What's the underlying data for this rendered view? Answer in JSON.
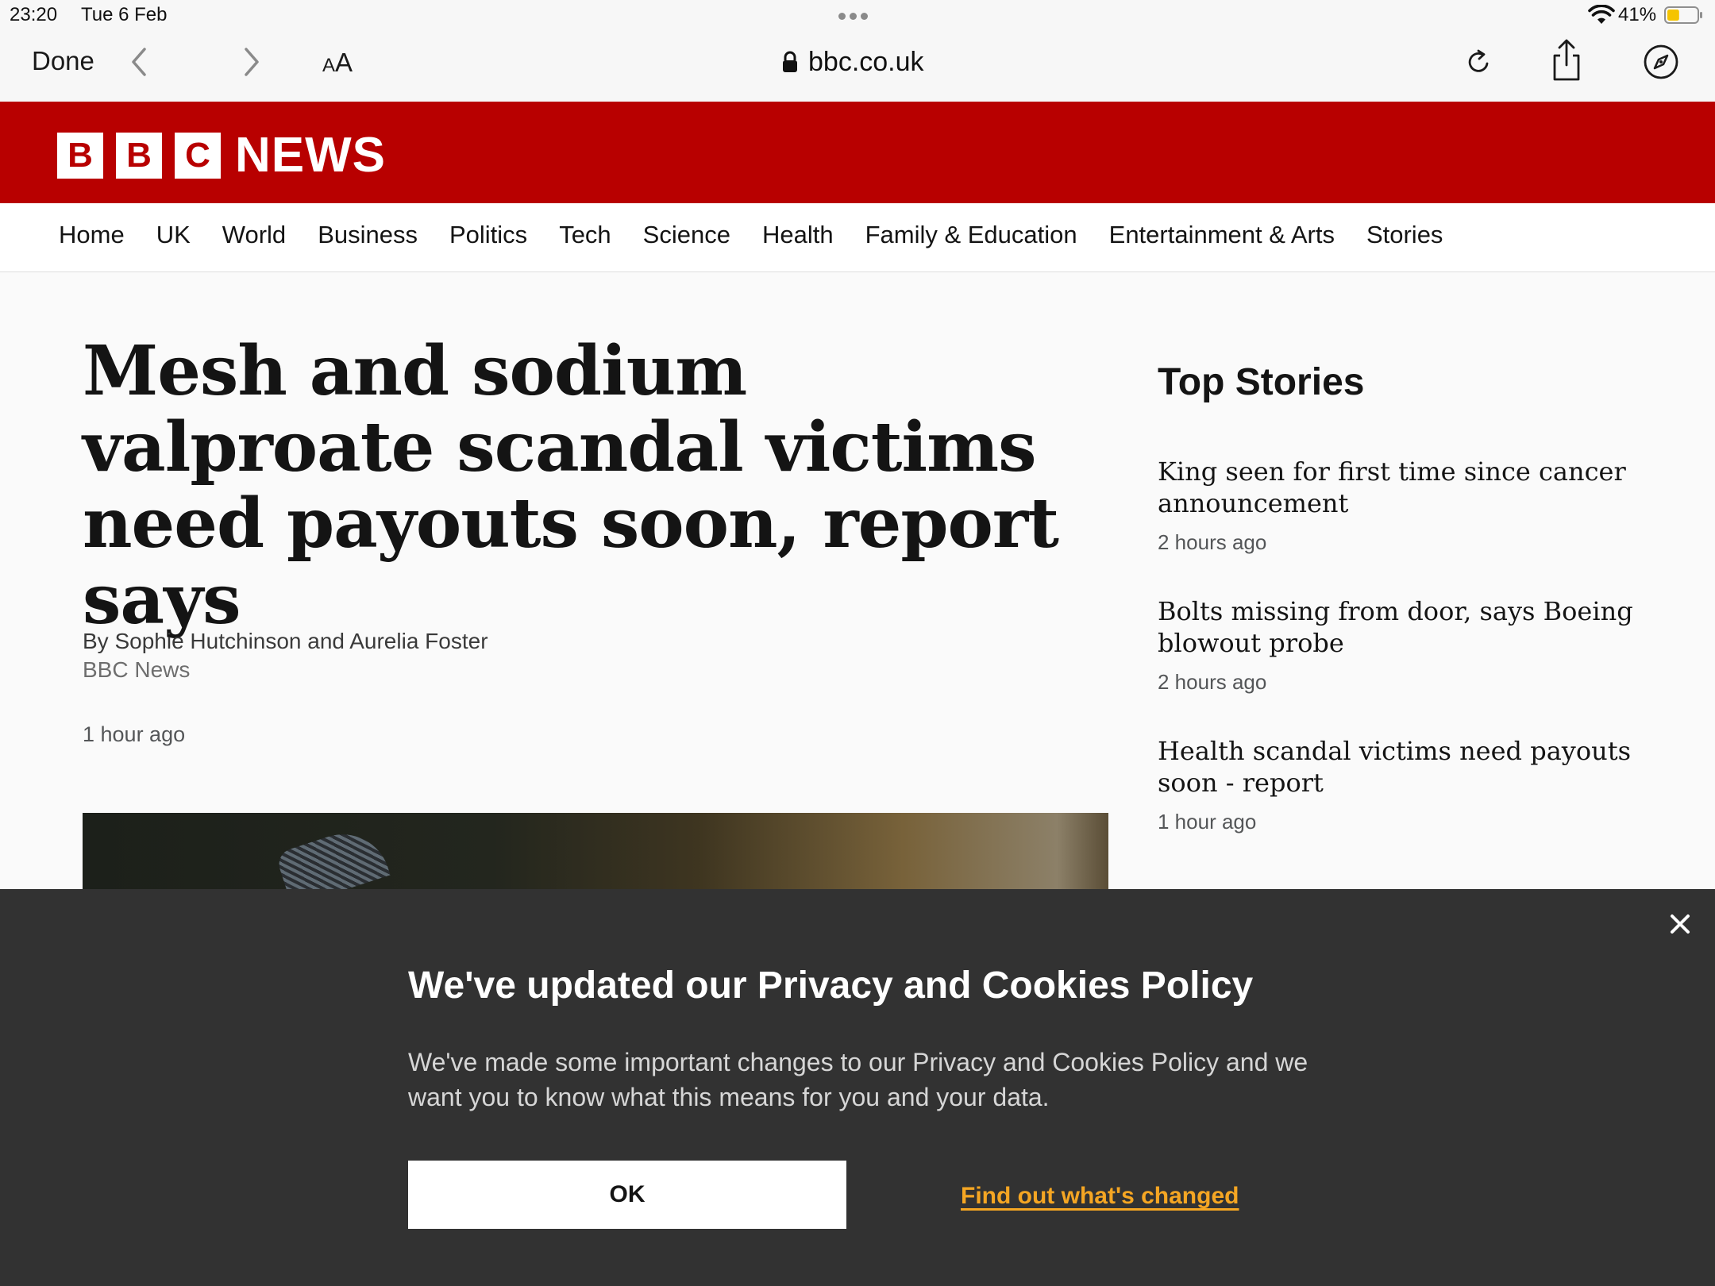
{
  "status_bar": {
    "time": "23:20",
    "date": "Tue 6 Feb",
    "battery_percent": "41%",
    "battery_level": 0.41,
    "battery_color": "#f5c400"
  },
  "toolbar": {
    "done_label": "Done",
    "text_size_small": "A",
    "text_size_large": "A",
    "url": "bbc.co.uk",
    "icons": [
      "back-icon",
      "forward-icon",
      "lock-icon",
      "reload-icon",
      "share-icon",
      "compass-icon"
    ]
  },
  "brand": {
    "blocks": [
      "B",
      "B",
      "C"
    ],
    "news": "NEWS",
    "header_color": "#b80000"
  },
  "nav": {
    "items": [
      "Home",
      "UK",
      "World",
      "Business",
      "Politics",
      "Tech",
      "Science",
      "Health",
      "Family & Education",
      "Entertainment & Arts",
      "Stories"
    ]
  },
  "article": {
    "headline": "Mesh and sodium valproate scandal victims need payouts soon, report says",
    "byline": "By Sophie Hutchinson and Aurelia Foster",
    "organisation": "BBC News",
    "time": "1 hour ago"
  },
  "top_stories": {
    "title": "Top Stories",
    "items": [
      {
        "headline": "King seen for first time since cancer announcement",
        "time": "2 hours ago"
      },
      {
        "headline": "Bolts missing from door, says Boeing blowout probe",
        "time": "2 hours ago"
      },
      {
        "headline": "Health scandal victims need payouts soon - report",
        "time": "1 hour ago"
      }
    ]
  },
  "cookie_banner": {
    "title": "We've updated our Privacy and Cookies Policy",
    "text": "We've made some important changes to our Privacy and Cookies Policy and we want you to know what this means for you and your data.",
    "ok_label": "OK",
    "link_label": "Find out what's changed",
    "link_color": "#f5a623",
    "close_icon": "close-icon"
  }
}
